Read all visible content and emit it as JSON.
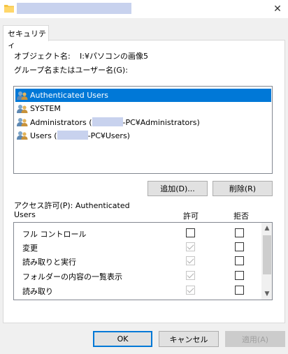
{
  "window": {
    "close_glyph": "✕"
  },
  "tabs": [
    {
      "label": "セキュリティ"
    }
  ],
  "object": {
    "label": "オブジェクト名:",
    "value": "I:¥パソコンの画像5"
  },
  "groups": {
    "label": "グループ名またはユーザー名(G):",
    "items": [
      {
        "label": "Authenticated Users",
        "selected": true
      },
      {
        "label": "SYSTEM",
        "selected": false
      },
      {
        "prefix": "Administrators (",
        "suffix": "-PC¥Administrators)",
        "selected": false
      },
      {
        "prefix": "Users (",
        "suffix": "-PC¥Users)",
        "selected": false
      }
    ]
  },
  "buttons": {
    "add": "追加(D)...",
    "remove": "削除(R)",
    "ok": "OK",
    "cancel": "キャンセル",
    "apply": "適用(A)"
  },
  "permissions": {
    "label_line1": "アクセス許可(P): Authenticated",
    "label_line2": "Users",
    "allow_header": "許可",
    "deny_header": "拒否",
    "rows": [
      {
        "name": "フル コントロール",
        "allow": "unchecked",
        "deny": "unchecked"
      },
      {
        "name": "変更",
        "allow": "disabled-checked",
        "deny": "unchecked"
      },
      {
        "name": "読み取りと実行",
        "allow": "disabled-checked",
        "deny": "unchecked"
      },
      {
        "name": "フォルダーの内容の一覧表示",
        "allow": "disabled-checked",
        "deny": "unchecked"
      },
      {
        "name": "読み取り",
        "allow": "disabled-checked",
        "deny": "unchecked"
      }
    ]
  },
  "icons": {
    "window": "folder-icon",
    "user": "users-group-icon"
  },
  "colors": {
    "selection": "#0078d7",
    "redaction": "#c8d2ee",
    "folder": "#f5c542"
  }
}
